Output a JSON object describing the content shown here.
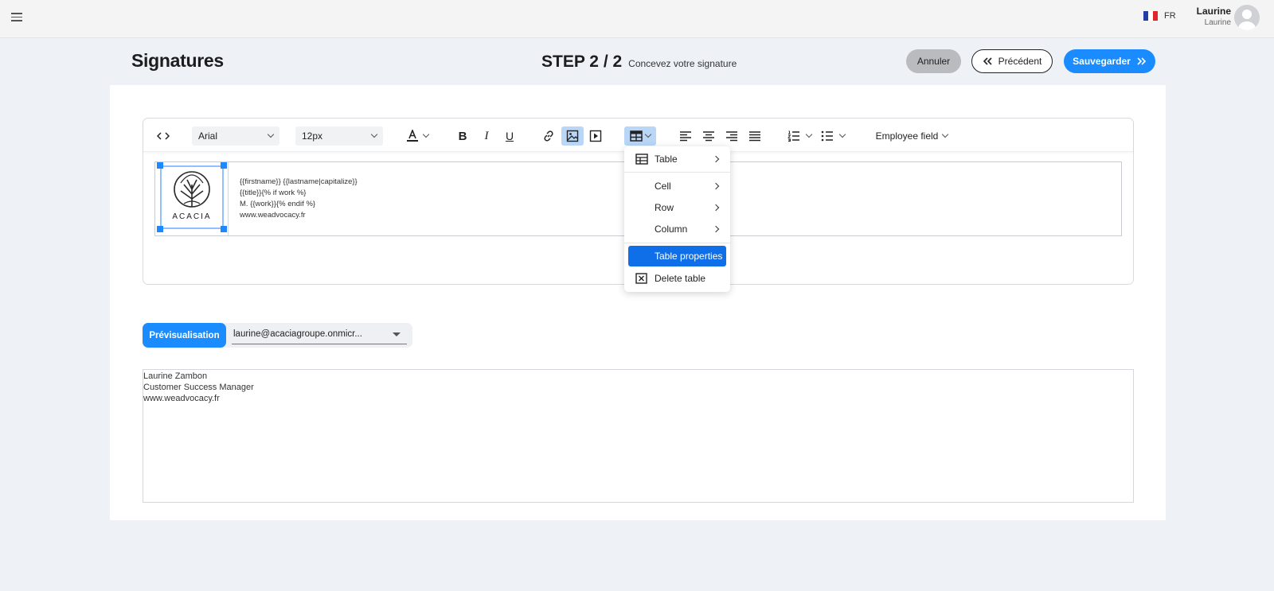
{
  "topbar": {
    "language": "FR",
    "user_name": "Laurine",
    "user_sub": "Laurine",
    "flag_colors": [
      "#1f3fa6",
      "#ffffff",
      "#e1252b"
    ]
  },
  "header": {
    "title": "Signatures",
    "step_label": "STEP 2 / 2",
    "step_description": "Concevez votre signature",
    "cancel_label": "Annuler",
    "previous_label": "Précédent",
    "save_label": "Sauvegarder"
  },
  "toolbar": {
    "font_family": "Arial",
    "font_size": "12px",
    "employee_field_label": "Employee field",
    "icons": [
      "code-icon",
      "text-color-icon",
      "bold-icon",
      "italic-icon",
      "underline-icon",
      "link-icon",
      "image-icon",
      "media-icon",
      "table-icon",
      "align-left-icon",
      "align-center-icon",
      "align-right-icon",
      "align-justify-icon",
      "numbered-list-icon",
      "bulleted-list-icon"
    ]
  },
  "signature": {
    "logo_text": "ACACIA",
    "lines": [
      "{{firstname}} {{lastname|capitalize}}",
      "{{title}}{% if work %}",
      "M. {{work}}{% endif %}",
      "www.weadvocacy.fr"
    ]
  },
  "table_menu": {
    "items": [
      {
        "label": "Table",
        "icon": "table-icon",
        "submenu": true
      },
      {
        "label": "Cell",
        "submenu": true
      },
      {
        "label": "Row",
        "submenu": true
      },
      {
        "label": "Column",
        "submenu": true
      },
      {
        "label": "Table properties",
        "highlighted": true
      },
      {
        "label": "Delete table",
        "icon": "delete-table-icon"
      }
    ]
  },
  "preview": {
    "button_label": "Prévisualisation",
    "selected_email": "laurine@acaciagroupe.onmicr...",
    "lines": [
      "Laurine Zambon",
      "Customer Success Manager",
      "www.weadvocacy.fr"
    ]
  },
  "colors": {
    "accent": "#1a8cff",
    "menu_highlight": "#0f6fe8",
    "selection": "#1e88ff",
    "background": "#eef2f7"
  }
}
